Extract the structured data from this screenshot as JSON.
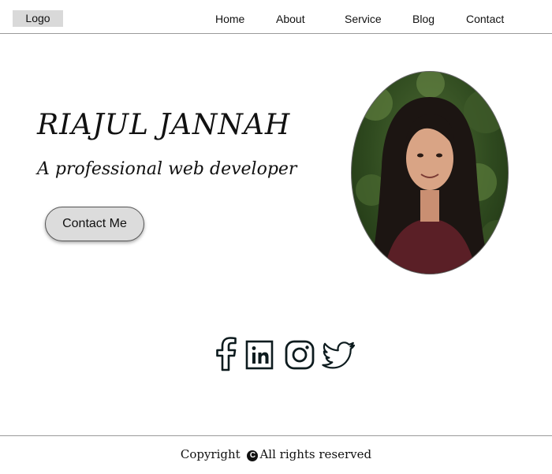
{
  "navbar": {
    "logo": "Logo",
    "links": [
      "Home",
      "About",
      "Service",
      "Blog",
      "Contact"
    ]
  },
  "hero": {
    "name": "RIAJUL JANNAH",
    "tagline": "A professional web developer",
    "button_label": "Contact Me"
  },
  "social": {
    "icons": [
      "facebook-icon",
      "linkedin-icon",
      "instagram-icon",
      "twitter-icon"
    ]
  },
  "footer": {
    "copyright_prefix": "Copyright",
    "copyright_symbol": "C",
    "copyright_suffix": "All rights reserved"
  },
  "colors": {
    "button_background": "#dcdcdc",
    "logo_background": "#d9d9d9",
    "icon_stroke": "#0d1b1e"
  }
}
